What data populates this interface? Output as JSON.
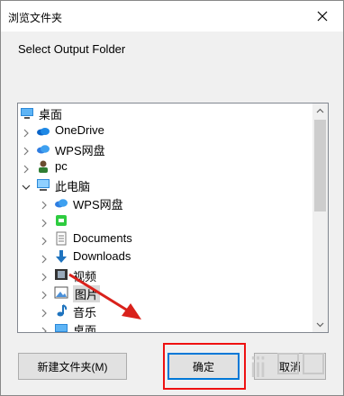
{
  "dialog": {
    "title": "浏览文件夹",
    "prompt": "Select Output Folder",
    "buttons": {
      "new_folder": "新建文件夹(M)",
      "ok": "确定",
      "cancel": "取消"
    }
  },
  "tree": {
    "items": [
      {
        "label": "桌面",
        "icon": "desktop-icon",
        "expandable": false,
        "level": 0
      },
      {
        "label": "OneDrive",
        "icon": "onedrive-cloud-icon",
        "expandable": true,
        "level": 1
      },
      {
        "label": "WPS网盘",
        "icon": "wps-cloud-icon",
        "expandable": true,
        "level": 1
      },
      {
        "label": "pc",
        "icon": "user-icon",
        "expandable": true,
        "level": 1
      },
      {
        "label": "此电脑",
        "icon": "computer-icon",
        "expandable": true,
        "expanded": true,
        "level": 1
      },
      {
        "label": "WPS网盘",
        "icon": "wps-cloud-icon",
        "expandable": true,
        "level": 2
      },
      {
        "label": "",
        "icon": "app-icon",
        "expandable": true,
        "level": 2
      },
      {
        "label": "Documents",
        "icon": "documents-icon",
        "expandable": true,
        "level": 2
      },
      {
        "label": "Downloads",
        "icon": "download-arrow-icon",
        "expandable": true,
        "level": 2
      },
      {
        "label": "视频",
        "icon": "video-icon",
        "expandable": true,
        "level": 2
      },
      {
        "label": "图片",
        "icon": "picture-icon",
        "expandable": true,
        "level": 2,
        "selected": true
      },
      {
        "label": "音乐",
        "icon": "music-icon",
        "expandable": true,
        "level": 2
      },
      {
        "label": "桌面",
        "icon": "desktop-icon",
        "expandable": true,
        "level": 2
      }
    ]
  },
  "colors": {
    "highlight_box": "#ee1111",
    "arrow": "#d9211b",
    "ok_border": "#0078d7"
  }
}
